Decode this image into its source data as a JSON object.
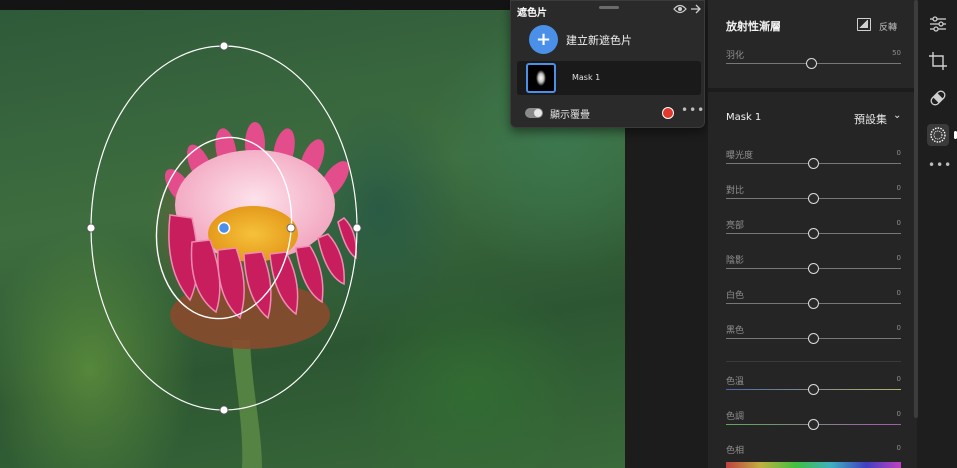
{
  "mask_panel": {
    "title": "遮色片",
    "create_label": "建立新遮色片",
    "create_icon": "+",
    "mask_name": "Mask 1",
    "overlay_label": "顯示覆疊",
    "overlay_color": "#e03a2e",
    "more": "•••"
  },
  "right_panel": {
    "title": "放射性漸層",
    "invert_label": "反轉",
    "feather": {
      "label": "羽化",
      "value": "50",
      "level": 0.49
    },
    "mask_section": {
      "name": "Mask 1",
      "preset_label": "預設集",
      "preset_chevron": "⌄",
      "sliders": [
        {
          "label": "曝光度",
          "value": "0",
          "level": 0.5
        },
        {
          "label": "對比",
          "value": "0",
          "level": 0.5
        },
        {
          "label": "亮部",
          "value": "0",
          "level": 0.5
        },
        {
          "label": "陰影",
          "value": "0",
          "level": 0.5
        },
        {
          "label": "白色",
          "value": "0",
          "level": 0.5
        },
        {
          "label": "黑色",
          "value": "0",
          "level": 0.5
        },
        {
          "label": "色溫",
          "value": "0",
          "level": 0.5
        },
        {
          "label": "色調",
          "value": "0",
          "level": 0.5
        }
      ],
      "hue": {
        "label": "色相",
        "value": "0"
      }
    }
  },
  "tools": {
    "items": [
      "sliders-icon",
      "crop-icon",
      "healing-icon",
      "masking-icon"
    ],
    "active": "masking-icon",
    "more": "•••"
  }
}
